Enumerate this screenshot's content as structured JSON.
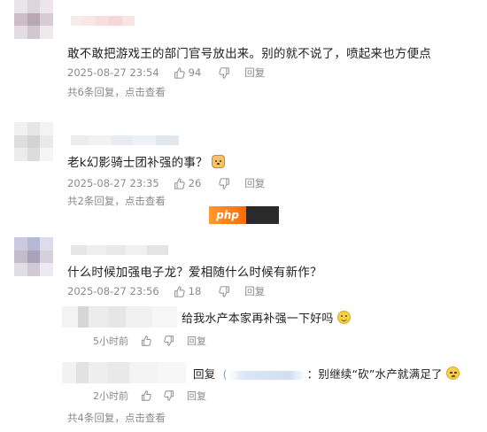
{
  "comments": [
    {
      "text": "敢不敢把游戏王的部门官号放出来。别的就不说了，喷起来也方便点",
      "date": "2025-08-27 23:54",
      "likes": "94",
      "reply_label": "回复",
      "more": "共6条回复，点击查看"
    },
    {
      "text": "老k幻影骑士团补强的事？",
      "emoji": "dog-face-emoji-icon",
      "date": "2025-08-27 23:35",
      "likes": "26",
      "reply_label": "回复",
      "more": "共2条回复，点击查看"
    },
    {
      "text": "什么时候加强电子龙？爱相随什么时候有新作？",
      "date": "2025-08-27 23:56",
      "likes": "18",
      "reply_label": "回复",
      "replies": [
        {
          "text": "给我水产本家再补强一下好吗",
          "emoji": "smile-emoji-icon",
          "time": "5小时前",
          "reply_label": "回复"
        },
        {
          "prefix": "回复",
          "open_paren": "(",
          "sep": "：",
          "text": "别继续“砍”水产就满足了",
          "emoji": "hmm-emoji-icon",
          "time": "2小时前",
          "reply_label": "回复"
        }
      ],
      "more": "共4条回复，点击查看"
    }
  ],
  "watermark": {
    "text": "php"
  },
  "colors": {
    "meta": "#8a8a8a",
    "text": "#222222",
    "watermark_orange": "#ff7a10"
  }
}
